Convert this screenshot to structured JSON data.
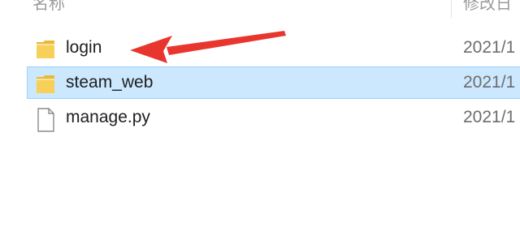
{
  "header": {
    "name_label": "名称",
    "date_label": "修改日"
  },
  "files": [
    {
      "name": "login",
      "date": "2021/1",
      "type": "folder-icon",
      "selected": false
    },
    {
      "name": "steam_web",
      "date": "2021/1",
      "type": "folder-icon",
      "selected": true
    },
    {
      "name": "manage.py",
      "date": "2021/1",
      "type": "file-icon",
      "selected": false
    }
  ],
  "colors": {
    "selection_bg": "#cce8ff",
    "selection_border": "#99d1ff",
    "folder_yellow": "#f7d05a",
    "arrow_red": "#e8362f"
  }
}
